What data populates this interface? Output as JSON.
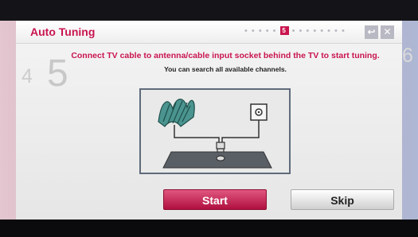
{
  "header": {
    "title": "Auto Tuning",
    "step_dots_before": "• • • • •",
    "current_step_badge": "5",
    "step_dots_after": "• • • • • • • •",
    "back_icon": "return-arrow-icon",
    "close_icon": "close-x-icon"
  },
  "steps": {
    "previous": "4",
    "current": "5",
    "next": "6"
  },
  "message": {
    "primary": "Connect TV cable to antenna/cable input socket behind the TV to start tuning.",
    "secondary": "You can search all available channels."
  },
  "diagram": {
    "description_icon": "antenna-cable-connection-diagram"
  },
  "buttons": {
    "start": "Start",
    "skip": "Skip"
  },
  "colors": {
    "accent": "#c9154f",
    "diagram_border": "#5f6b7a",
    "antenna": "#3f8a86"
  }
}
